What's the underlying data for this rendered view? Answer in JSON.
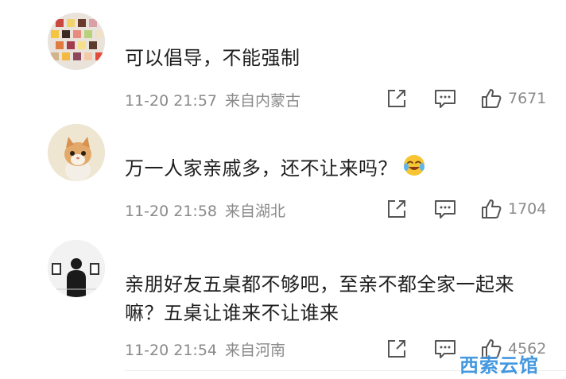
{
  "comments": [
    {
      "text": "可以倡导，不能强制",
      "time": "11-20 21:57",
      "location": "来自内蒙古",
      "likes": "7671",
      "avatar": "dessert-cubes-avatar"
    },
    {
      "text": "万一人家亲戚多，还不让来吗？",
      "emoji": "laughing-crying-emoji",
      "time": "11-20 21:58",
      "location": "来自湖北",
      "likes": "1704",
      "avatar": "kitten-avatar"
    },
    {
      "text_line1": "亲朋好友五桌都不够吧，至亲不都全家一起来",
      "text_line2": "嘛？五桌让谁来不让谁来",
      "time": "11-20 21:54",
      "location": "来自河南",
      "likes": "4562",
      "avatar": "gallery-silhouette-avatar"
    }
  ],
  "icons": {
    "repost": "repost-icon",
    "comment": "comment-icon",
    "like": "thumbs-up-icon"
  },
  "watermark": "西索云馆",
  "colors": {
    "text": "#1f1f1f",
    "meta": "#8a8a8a",
    "watermark": "#2f8ddc"
  }
}
